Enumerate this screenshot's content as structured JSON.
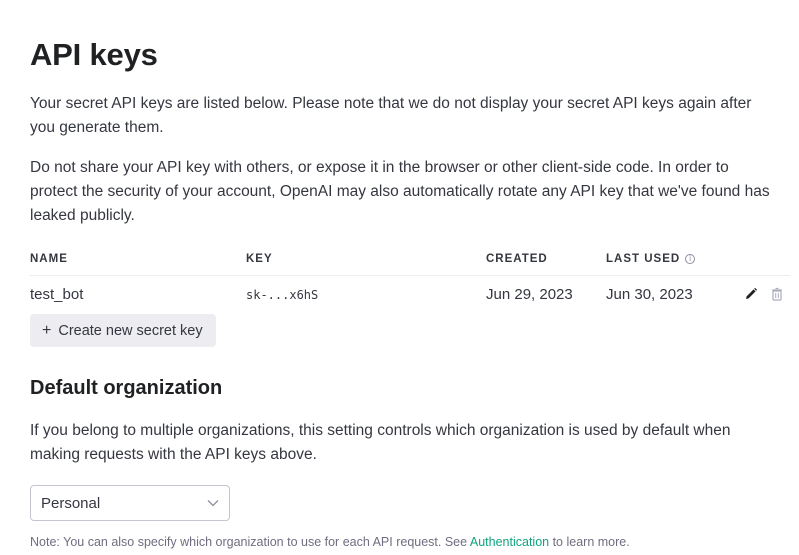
{
  "page": {
    "title": "API keys",
    "intro_1": "Your secret API keys are listed below. Please note that we do not display your secret API keys again after you generate them.",
    "intro_2": "Do not share your API key with others, or expose it in the browser or other client-side code. In order to protect the security of your account, OpenAI may also automatically rotate any API key that we've found has leaked publicly."
  },
  "table": {
    "headers": {
      "name": "NAME",
      "key": "KEY",
      "created": "CREATED",
      "last_used": "LAST USED"
    },
    "rows": [
      {
        "name": "test_bot",
        "key": "sk-...x6hS",
        "created": "Jun 29, 2023",
        "last_used": "Jun 30, 2023"
      }
    ]
  },
  "actions": {
    "create_key_label": "Create new secret key",
    "create_icon": "plus-icon",
    "row_icons": [
      "pencil-icon",
      "trash-icon"
    ],
    "header_icon": "info-icon"
  },
  "default_org": {
    "heading": "Default organization",
    "description": "If you belong to multiple organizations, this setting controls which organization is used by default when making requests with the API keys above.",
    "selected": "Personal",
    "note_prefix": "Note: You can also specify which organization to use for each API request. See ",
    "note_link": "Authentication",
    "note_suffix": " to learn more."
  },
  "colors": {
    "accent": "#10a37f",
    "button_bg": "#ececf1",
    "text": "#353740"
  }
}
